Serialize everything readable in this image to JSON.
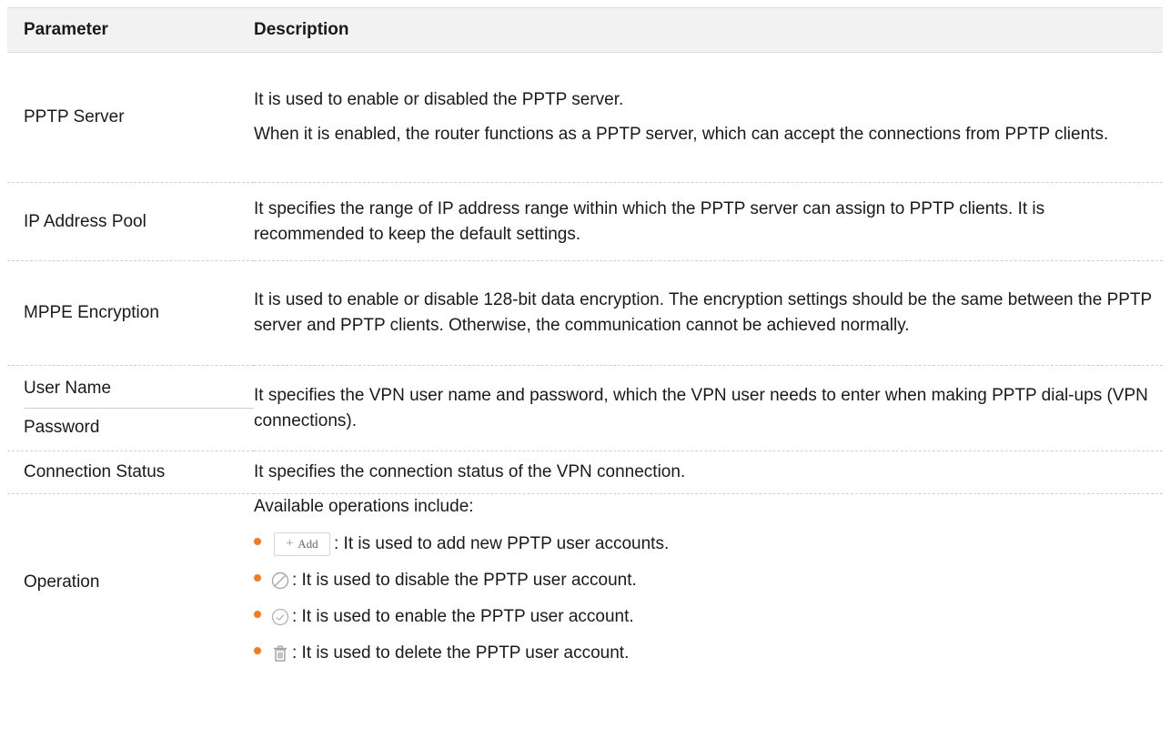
{
  "table": {
    "headers": {
      "parameter": "Parameter",
      "description": "Description"
    },
    "rows": {
      "pptp_server": {
        "parameter": "PPTP Server",
        "description": [
          "It is used to enable or disabled the PPTP server.",
          "When it is enabled, the router functions as a PPTP server, which can accept the connections from PPTP clients."
        ]
      },
      "ip_pool": {
        "parameter": "IP Address Pool",
        "description": "It specifies the range of IP address range within which the PPTP server can assign to PPTP clients. It is recommended to keep the default settings."
      },
      "mppe": {
        "parameter": "MPPE Encryption",
        "description": "It is used to enable or disable 128-bit data encryption. The encryption settings should be the same between the PPTP server and PPTP clients. Otherwise, the communication cannot be achieved normally."
      },
      "user_pass": {
        "parameter_user": "User Name",
        "parameter_pass": "Password",
        "description": "It specifies the VPN user name and password, which the VPN user needs to enter when making PPTP dial-ups (VPN connections)."
      },
      "conn_status": {
        "parameter": "Connection Status",
        "description": "It specifies the connection status of the VPN connection."
      },
      "operation": {
        "parameter": "Operation",
        "intro": "Available operations include:",
        "add_button_label": "Add",
        "items": [
          {
            "icon": "add-button",
            "text": ": It is used to add new PPTP user accounts."
          },
          {
            "icon": "disable-icon",
            "text": ": It is used to disable the PPTP user account."
          },
          {
            "icon": "enable-icon",
            "text": ": It is used to enable the PPTP user account."
          },
          {
            "icon": "delete-icon",
            "text": ": It is used to delete the PPTP user account."
          }
        ]
      }
    }
  },
  "colors": {
    "bullet": "#f47a20",
    "header_bg": "#f2f2f2",
    "icon_gray": "#a8a8a8"
  }
}
